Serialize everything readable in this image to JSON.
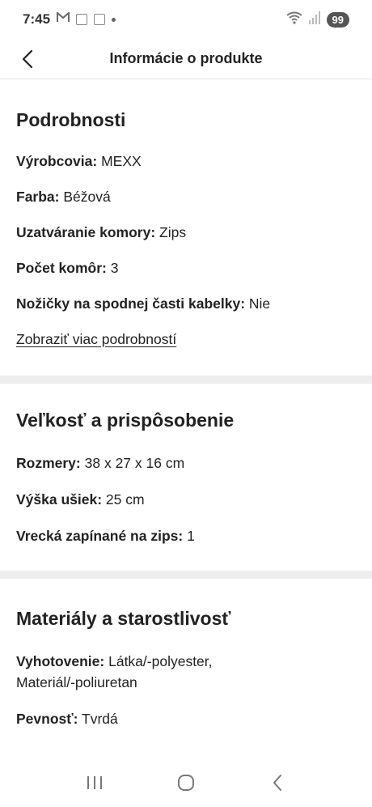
{
  "status_bar": {
    "time": "7:45",
    "battery": "99"
  },
  "header": {
    "title": "Informácie o produkte"
  },
  "sections": {
    "details": {
      "title": "Podrobnosti",
      "rows": [
        {
          "key": "Výrobcovia:",
          "value": "MEXX"
        },
        {
          "key": "Farba:",
          "value": "Béžová"
        },
        {
          "key": "Uzatváranie komory:",
          "value": "Zips"
        },
        {
          "key": "Počet komôr:",
          "value": "3"
        },
        {
          "key": "Nožičky na spodnej časti kabelky:",
          "value": "Nie"
        }
      ],
      "more_link": "Zobraziť viac podrobností"
    },
    "size": {
      "title": "Veľkosť a prispôsobenie",
      "rows": [
        {
          "key": "Rozmery:",
          "value": "38 x 27 x 16 cm"
        },
        {
          "key": "Výška ušiek:",
          "value": "25 cm"
        },
        {
          "key": "Vrecká zapínané na zips:",
          "value": "1"
        }
      ]
    },
    "materials": {
      "title": "Materiály a starostlivosť",
      "rows": [
        {
          "key": "Vyhotovenie:",
          "value": "Látka/-polyester,",
          "value_line2": "Materiál/-poliuretan"
        },
        {
          "key": "Pevnosť:",
          "value": "Tvrdá"
        }
      ]
    }
  },
  "icons": {
    "back": "chevron-left-icon",
    "gmail": "gmail-icon",
    "wifi": "wifi-icon",
    "signal": "signal-icon"
  }
}
